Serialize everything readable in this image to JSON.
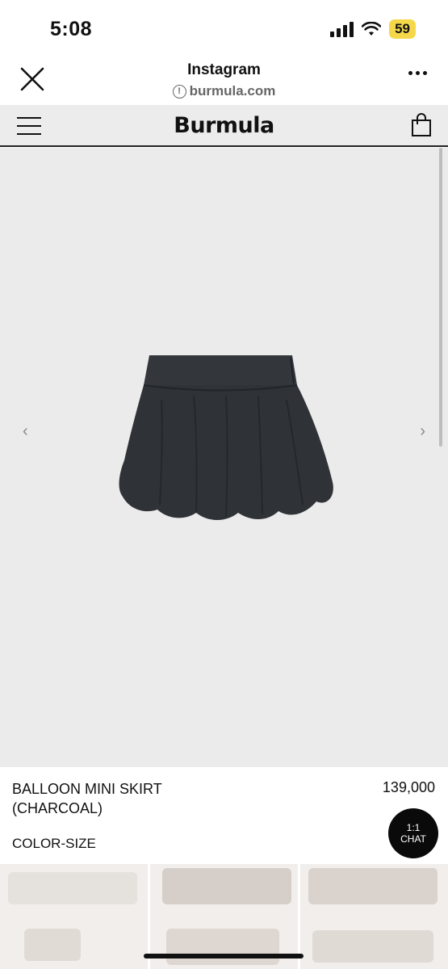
{
  "status_bar": {
    "time": "5:08",
    "battery": "59",
    "battery_color": "#f5d84a"
  },
  "browser": {
    "title": "Instagram",
    "url": "burmula.com",
    "close_icon": "close-icon",
    "more_icon": "more-options-icon",
    "info_icon": "info-icon"
  },
  "site_nav": {
    "logo": "Burmula",
    "menu_icon": "hamburger-menu-icon",
    "bag_icon": "shopping-bag-icon"
  },
  "product": {
    "name": "BALLOON MINI SKIRT (CHARCOAL)",
    "price": "139,000",
    "option_label": "COLOR-SIZE",
    "image_description_icon": "skirt-image",
    "prev_arrow": "‹",
    "next_arrow": "›"
  },
  "chat_button": {
    "line1": "1:1",
    "line2": "CHAT"
  }
}
